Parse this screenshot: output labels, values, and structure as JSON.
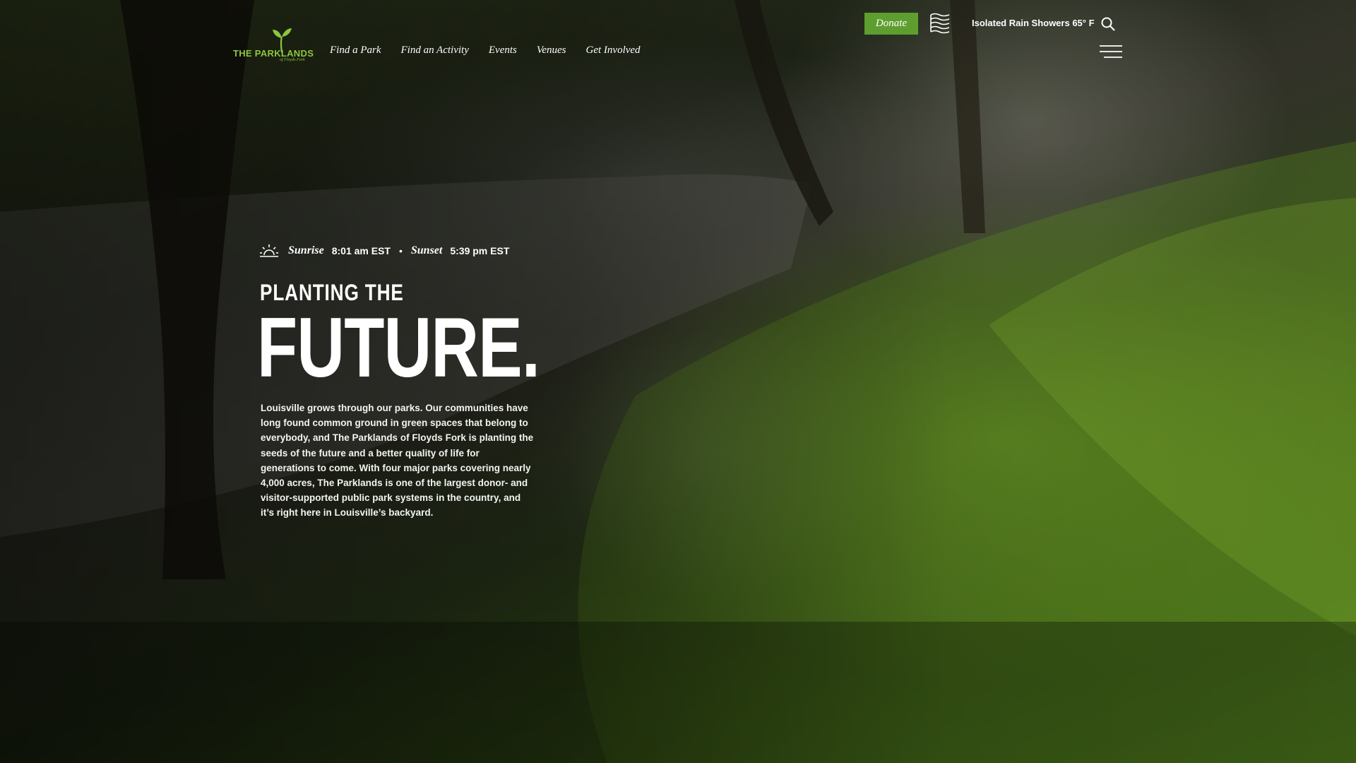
{
  "header": {
    "logo": {
      "name": "THE PARKLANDS",
      "sub": "of Floyds Fork",
      "color": "#8cc63f",
      "icon": "sprout-icon"
    },
    "nav": [
      {
        "label": "Find a Park"
      },
      {
        "label": "Find an Activity"
      },
      {
        "label": "Events"
      },
      {
        "label": "Venues"
      },
      {
        "label": "Get Involved"
      }
    ],
    "donate_label": "Donate",
    "donate_color": "#5e9e2f",
    "weather": {
      "text": "Isolated Rain Showers 65° F",
      "icon": "flag-icon"
    },
    "search_icon": "search-icon",
    "menu_icon": "hamburger-menu-icon"
  },
  "hero": {
    "sun": {
      "sunrise_label": "Sunrise",
      "sunrise_time": "8:01 am EST",
      "separator": "•",
      "sunset_label": "Sunset",
      "sunset_time": "5:39 pm EST",
      "icon": "sunrise-icon"
    },
    "kicker": "PLANTING THE",
    "title": "FUTURE.",
    "body": "Louisville grows through our parks. Our communities have long found common ground in green spaces that belong to everybody, and The Parklands of Floyds Fork is planting the seeds of the future and a better quality of life for generations to come. With four major parks covering nearly 4,000 acres, The Parklands is one of the largest donor- and visitor-supported public park systems in the country, and it’s right here in Louisville’s backyard."
  }
}
